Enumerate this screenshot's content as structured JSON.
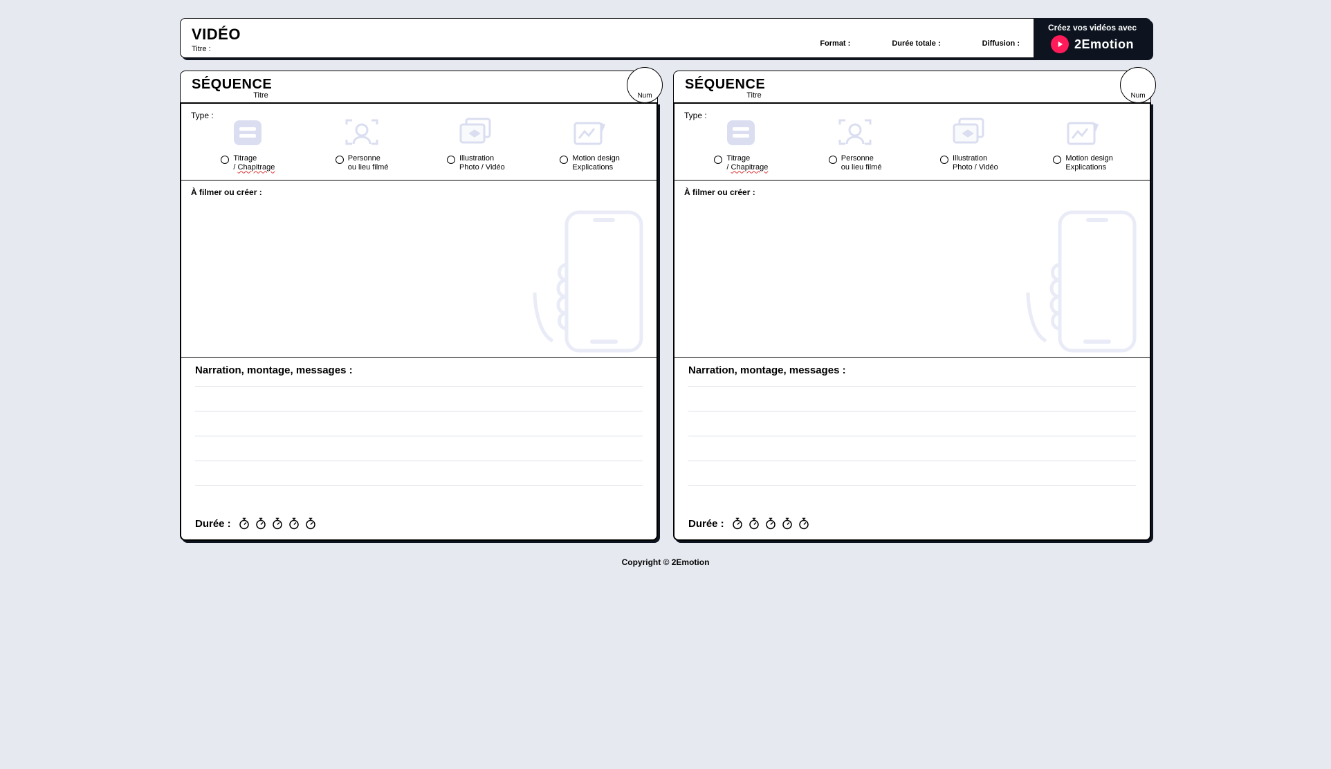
{
  "header": {
    "title": "VIDÉO",
    "titre_label": "Titre :",
    "format_label": "Format :",
    "duree_totale_label": "Durée totale :",
    "diffusion_label": "Diffusion :"
  },
  "brand": {
    "tagline": "Créez vos vidéos avec",
    "name": "2Emotion"
  },
  "sequence": {
    "heading": "SÉQUENCE",
    "titre_label": "Titre",
    "num_label": "Num",
    "type_label": "Type :",
    "options": [
      {
        "line1": "Titrage",
        "line2_prefix": "/ ",
        "line2_underlined": "Chapitrage"
      },
      {
        "line1": "Personne",
        "line2": "ou lieu filmé"
      },
      {
        "line1": "Illustration",
        "line2": "Photo / Vidéo"
      },
      {
        "line1": "Motion design",
        "line2": "Explications"
      }
    ],
    "film_label": "À filmer ou créer :",
    "narration_label": "Narration, montage, messages :",
    "duree_label": "Durée :"
  },
  "footer": "Copyright © 2Emotion"
}
